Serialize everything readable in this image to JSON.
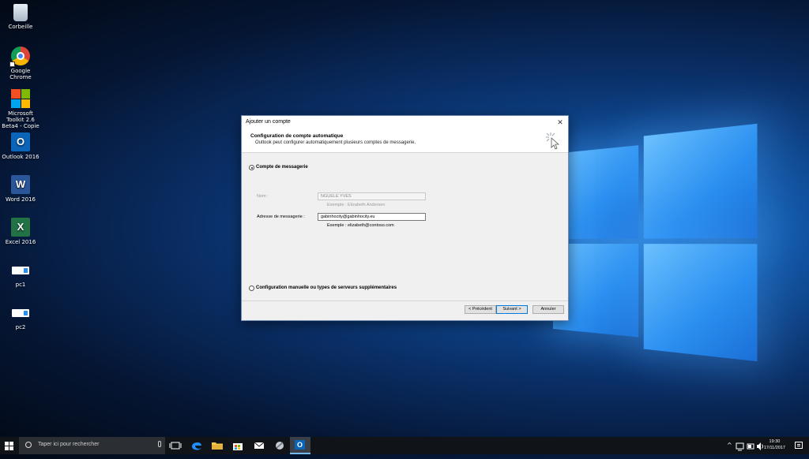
{
  "desktop": {
    "icons": [
      {
        "label": "Corbeille",
        "icon": "recycle-bin-icon"
      },
      {
        "label": "Google Chrome",
        "icon": "chrome-icon"
      },
      {
        "label": "Microsoft Toolkit 2.6 Beta4 - Copie",
        "icon": "microsoft-toolkit-icon"
      },
      {
        "label": "Outlook 2016",
        "icon": "outlook-icon"
      },
      {
        "label": "Word 2016",
        "icon": "word-icon"
      },
      {
        "label": "Excel 2016",
        "icon": "excel-icon"
      },
      {
        "label": "pc1",
        "icon": "pc-icon"
      },
      {
        "label": "pc2",
        "icon": "pc-icon"
      }
    ],
    "office_letters": {
      "outlook": "O",
      "word": "W",
      "excel": "X"
    }
  },
  "dialog": {
    "title": "Ajouter un compte",
    "close_glyph": "✕",
    "header": {
      "title": "Configuration de compte automatique",
      "subtitle": "Outlook peut configurer automatiquement plusieurs comptes de messagerie."
    },
    "options": {
      "email_account": {
        "label": "Compte de messagerie",
        "selected": true
      },
      "manual": {
        "label": "Configuration manuelle ou types de serveurs supplémentaires",
        "selected": false
      }
    },
    "fields": {
      "name": {
        "label": "Nom :",
        "value": "NGUELE YVES",
        "hint": "Exemple : Elizabeth Andersen",
        "enabled": false
      },
      "email": {
        "label": "Adresse de messagerie :",
        "value": "gabinhocity@gabinhocity.eu",
        "hint": "Exemple : elizabeth@contoso.com",
        "enabled": true
      }
    },
    "buttons": {
      "back": "< Précédent",
      "next": "Suivant >",
      "cancel": "Annuler"
    }
  },
  "taskbar": {
    "search_placeholder": "Taper ici pour rechercher",
    "pinned": [
      "task-view-icon",
      "edge-icon",
      "file-explorer-icon",
      "store-icon",
      "mail-icon",
      "app-icon",
      "outlook-icon"
    ],
    "tray_chevron": "^",
    "clock": {
      "time": "19:30",
      "date": "17/11/2017"
    }
  },
  "colors": {
    "accent": "#0078d7",
    "taskbar": "#101418"
  }
}
